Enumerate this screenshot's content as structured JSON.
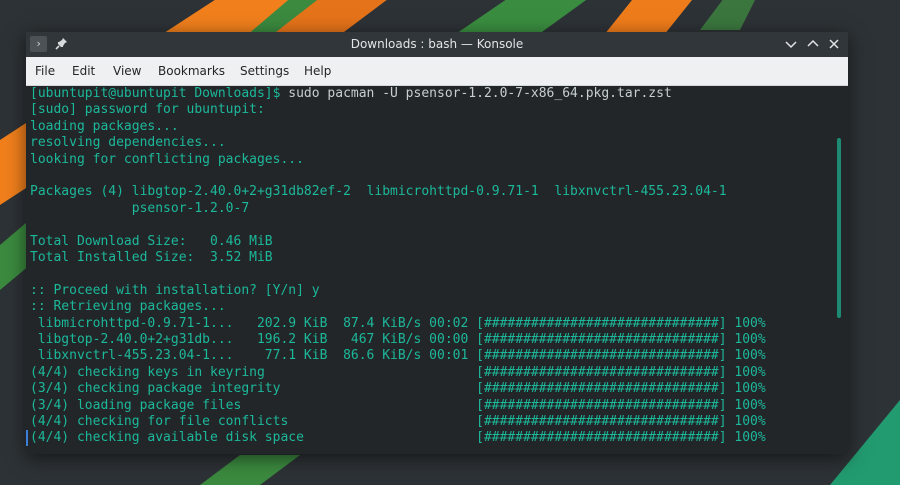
{
  "window": {
    "title": "Downloads : bash — Konsole",
    "app_icon_glyph": "›",
    "icons": [
      "terminal-icon",
      "pin-icon",
      "minimize-icon",
      "maximize-icon",
      "close-icon"
    ]
  },
  "menubar": {
    "items": [
      "File",
      "Edit",
      "View",
      "Bookmarks",
      "Settings",
      "Help"
    ]
  },
  "terminal": {
    "prompt": "[ubuntupit@ubuntupit Downloads]$",
    "command": " sudo pacman -U psensor-1.2.0-7-x86_64.pkg.tar.zst",
    "lines": [
      "[sudo] password for ubuntupit:",
      "loading packages...",
      "resolving dependencies...",
      "looking for conflicting packages...",
      "",
      "Packages (4) libgtop-2.40.0+2+g31db82ef-2  libmicrohttpd-0.9.71-1  libxnvctrl-455.23.04-1",
      "             psensor-1.2.0-7",
      "",
      "Total Download Size:   0.46 MiB",
      "Total Installed Size:  3.52 MiB",
      "",
      ":: Proceed with installation? [Y/n] y",
      ":: Retrieving packages...",
      " libmicrohttpd-0.9.71-1...   202.9 KiB  87.4 KiB/s 00:02 [##############################] 100%",
      " libgtop-2.40.0+2+g31db...   196.2 KiB   467 KiB/s 00:00 [##############################] 100%",
      " libxnvctrl-455.23.04-1...    77.1 KiB  86.6 KiB/s 00:01 [##############################] 100%",
      "(4/4) checking keys in keyring                           [##############################] 100%",
      "(3/4) checking package integrity                         [##############################] 100%",
      "(3/4) loading package files                              [##############################] 100%",
      "(4/4) checking for file conflicts                        [##############################] 100%",
      "(4/4) checking available disk space                      [##############################] 100%"
    ]
  },
  "colors": {
    "terminal_bg": "#232629",
    "terminal_fg": "#1cb89a",
    "command_fg": "#c6cfcc",
    "titlebar_bg": "#31363b",
    "menubar_bg": "#eff0f1",
    "wallpaper_orange": "#f07f1c",
    "wallpaper_green": "#2e7d32"
  }
}
